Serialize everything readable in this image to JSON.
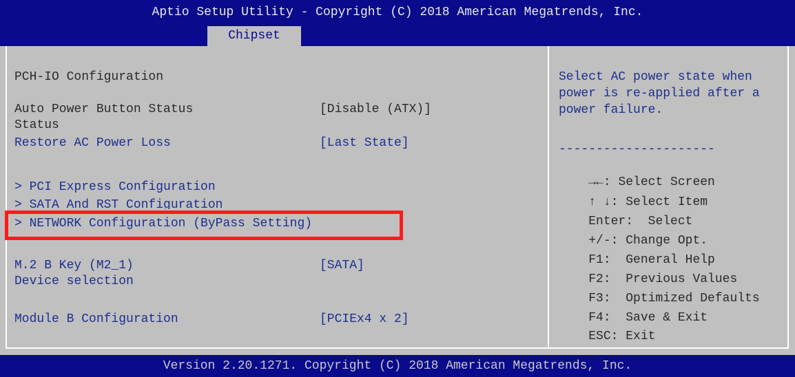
{
  "header": {
    "title": "Aptio Setup Utility - Copyright (C) 2018 American Megatrends, Inc.",
    "active_tab": "Chipset"
  },
  "main": {
    "section_title": "PCH-IO Configuration",
    "items": [
      {
        "label": "Auto Power Button Status",
        "label2": "Status",
        "value": "[Disable (ATX)]"
      },
      {
        "label": "Restore AC Power Loss",
        "value": "[Last State]"
      },
      {
        "label": "> PCI Express Configuration"
      },
      {
        "label": "> SATA And RST Configuration"
      },
      {
        "label": "> NETWORK Configuration (ByPass Setting)"
      },
      {
        "label": "M.2 B Key (M2_1)",
        "label2": "Device selection",
        "value": "[SATA]"
      },
      {
        "label": "Module B Configuration",
        "value": "[PCIEx4 x 2]"
      }
    ]
  },
  "help": {
    "lines": [
      "Select AC power state when",
      "power is re-applied after a",
      "power failure."
    ],
    "separator": "---------------------",
    "keys": [
      {
        "key": "→←:",
        "desc": "Select Screen"
      },
      {
        "key": "↑ ↓:",
        "desc": "Select Item"
      },
      {
        "key": "Enter:",
        "desc": "Select"
      },
      {
        "key": "+/-:",
        "desc": "Change Opt."
      },
      {
        "key": "F1:",
        "desc": "General Help"
      },
      {
        "key": "F2:",
        "desc": "Previous Values"
      },
      {
        "key": "F3:",
        "desc": "Optimized Defaults"
      },
      {
        "key": "F4:",
        "desc": "Save & Exit"
      },
      {
        "key": "ESC:",
        "desc": "Exit"
      }
    ]
  },
  "footer": {
    "text": "Version 2.20.1271. Copyright (C) 2018 American Megatrends, Inc."
  },
  "colors": {
    "header_bg": "#0a0a8c",
    "panel_bg": "#c0c0c0",
    "accent_text": "#1c2f8e",
    "highlight_box": "#ff1a1a"
  }
}
